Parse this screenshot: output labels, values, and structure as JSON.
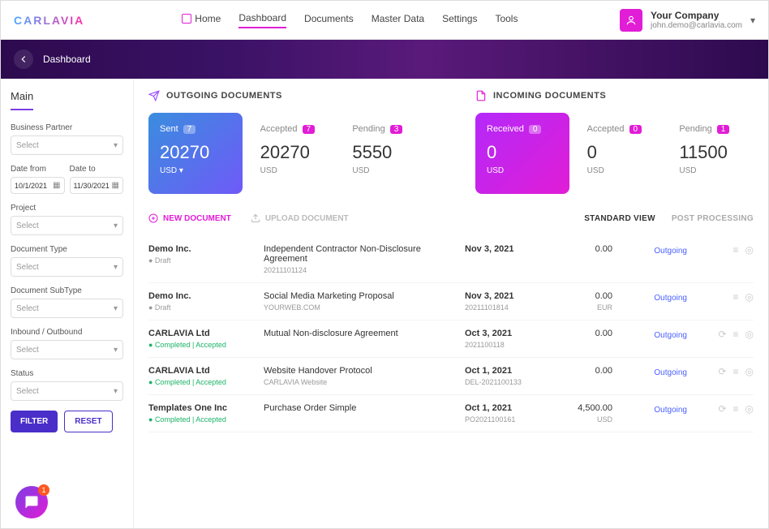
{
  "logo": "CARLAVIA",
  "nav": {
    "items": [
      "Home",
      "Dashboard",
      "Documents",
      "Master Data",
      "Settings",
      "Tools"
    ]
  },
  "user": {
    "company": "Your Company",
    "email": "john.demo@carlavia.com"
  },
  "breadcrumb": "Dashboard",
  "sidebar": {
    "main_tab": "Main",
    "business_partner_label": "Business Partner",
    "date_from_label": "Date from",
    "date_from_value": "10/1/2021",
    "date_to_label": "Date to",
    "date_to_value": "11/30/2021",
    "project_label": "Project",
    "doctype_label": "Document Type",
    "subtype_label": "Document SubType",
    "inbound_label": "Inbound / Outbound",
    "status_label": "Status",
    "select_placeholder": "Select",
    "filter_btn": "FILTER",
    "reset_btn": "RESET",
    "notif_count": "1"
  },
  "outgoing": {
    "title": "OUTGOING DOCUMENTS",
    "sent_label": "Sent",
    "sent_count": "7",
    "sent_value": "20270",
    "sent_unit": "USD",
    "accepted_label": "Accepted",
    "accepted_count": "7",
    "accepted_value": "20270",
    "accepted_unit": "USD",
    "pending_label": "Pending",
    "pending_count": "3",
    "pending_value": "5550",
    "pending_unit": "USD"
  },
  "incoming": {
    "title": "INCOMING DOCUMENTS",
    "received_label": "Received",
    "received_count": "0",
    "received_value": "0",
    "received_unit": "USD",
    "accepted_label": "Accepted",
    "accepted_count": "0",
    "accepted_value": "0",
    "accepted_unit": "USD",
    "pending_label": "Pending",
    "pending_count": "1",
    "pending_value": "11500",
    "pending_unit": "USD"
  },
  "actions": {
    "new_doc": "NEW DOCUMENT",
    "upload_doc": "UPLOAD DOCUMENT",
    "standard_view": "STANDARD VIEW",
    "post_processing": "POST PROCESSING"
  },
  "docs": [
    {
      "company": "Demo Inc.",
      "status": "Draft",
      "status_done": false,
      "title": "Independent Contractor Non-Disclosure Agreement",
      "sub": "20211101124",
      "date": "Nov 3, 2021",
      "num": "",
      "amt": "0.00",
      "cur": "",
      "dir": "Outgoing",
      "icons": "basic"
    },
    {
      "company": "Demo Inc.",
      "status": "Draft",
      "status_done": false,
      "title": "Social Media Marketing Proposal",
      "sub": "YOURWEB.COM",
      "date": "Nov 3, 2021",
      "num": "20211101814",
      "amt": "0.00",
      "cur": "EUR",
      "dir": "Outgoing",
      "icons": "basic"
    },
    {
      "company": "CARLAVIA Ltd",
      "status": "Completed | Accepted",
      "status_done": true,
      "title": "Mutual Non-disclosure Agreement",
      "sub": "",
      "date": "Oct 3, 2021",
      "num": "2021100118",
      "amt": "0.00",
      "cur": "",
      "dir": "Outgoing",
      "icons": "full"
    },
    {
      "company": "CARLAVIA Ltd",
      "status": "Completed | Accepted",
      "status_done": true,
      "title": "Website Handover Protocol",
      "sub": "CARLAVIA Website",
      "date": "Oct 1, 2021",
      "num": "DEL-2021100133",
      "amt": "0.00",
      "cur": "",
      "dir": "Outgoing",
      "icons": "full"
    },
    {
      "company": "Templates One Inc",
      "status": "Completed | Accepted",
      "status_done": true,
      "title": "Purchase Order Simple",
      "sub": "",
      "date": "Oct 1, 2021",
      "num": "PO2021100161",
      "amt": "4,500.00",
      "cur": "USD",
      "dir": "Outgoing",
      "icons": "full"
    }
  ]
}
